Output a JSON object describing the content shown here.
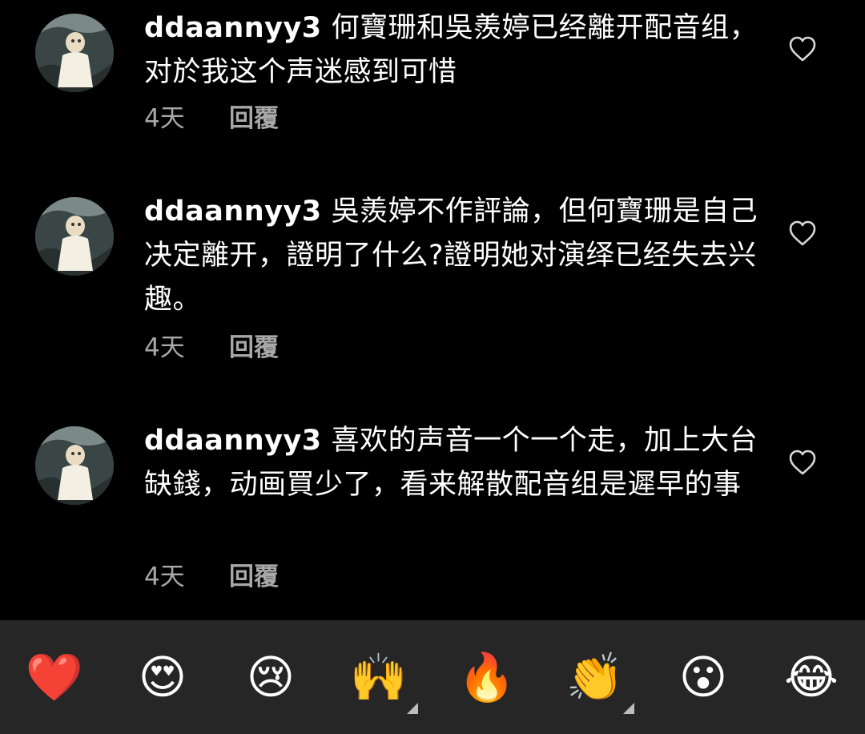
{
  "comments": [
    {
      "username": "ddaannyy3",
      "text": "何寶珊和吳羨婷已经離开配音组，对於我这个声迷感到可惜",
      "time": "4天",
      "reply_label": "回覆",
      "avatar_icon": "profile-photo"
    },
    {
      "username": "ddaannyy3",
      "text": "吳羨婷不作評論，但何寶珊是自己决定離开，證明了什么?證明她对演绎已经失去兴趣。",
      "time": "4天",
      "reply_label": "回覆",
      "avatar_icon": "profile-photo"
    },
    {
      "username": "ddaannyy3",
      "text": "喜欢的声音一个一个走，加上大台缺錢，动画買少了，看来解散配音组是遲早的事",
      "time": "4天",
      "reply_label": "回覆",
      "avatar_icon": "profile-photo"
    }
  ],
  "emoji_bar": {
    "items": [
      "❤️",
      "😍",
      "😢",
      "🙌",
      "🔥",
      "👏",
      "😮",
      "😂"
    ],
    "names": [
      "red-heart",
      "heart-eyes",
      "crying-face",
      "raised-hands",
      "fire",
      "clapping-hands",
      "surprised-face",
      "tears-of-joy"
    ]
  },
  "colors": {
    "background": "#000000",
    "text": "#ffffff",
    "meta": "#a8a8a8",
    "emoji_bar_bg": "#262626"
  }
}
